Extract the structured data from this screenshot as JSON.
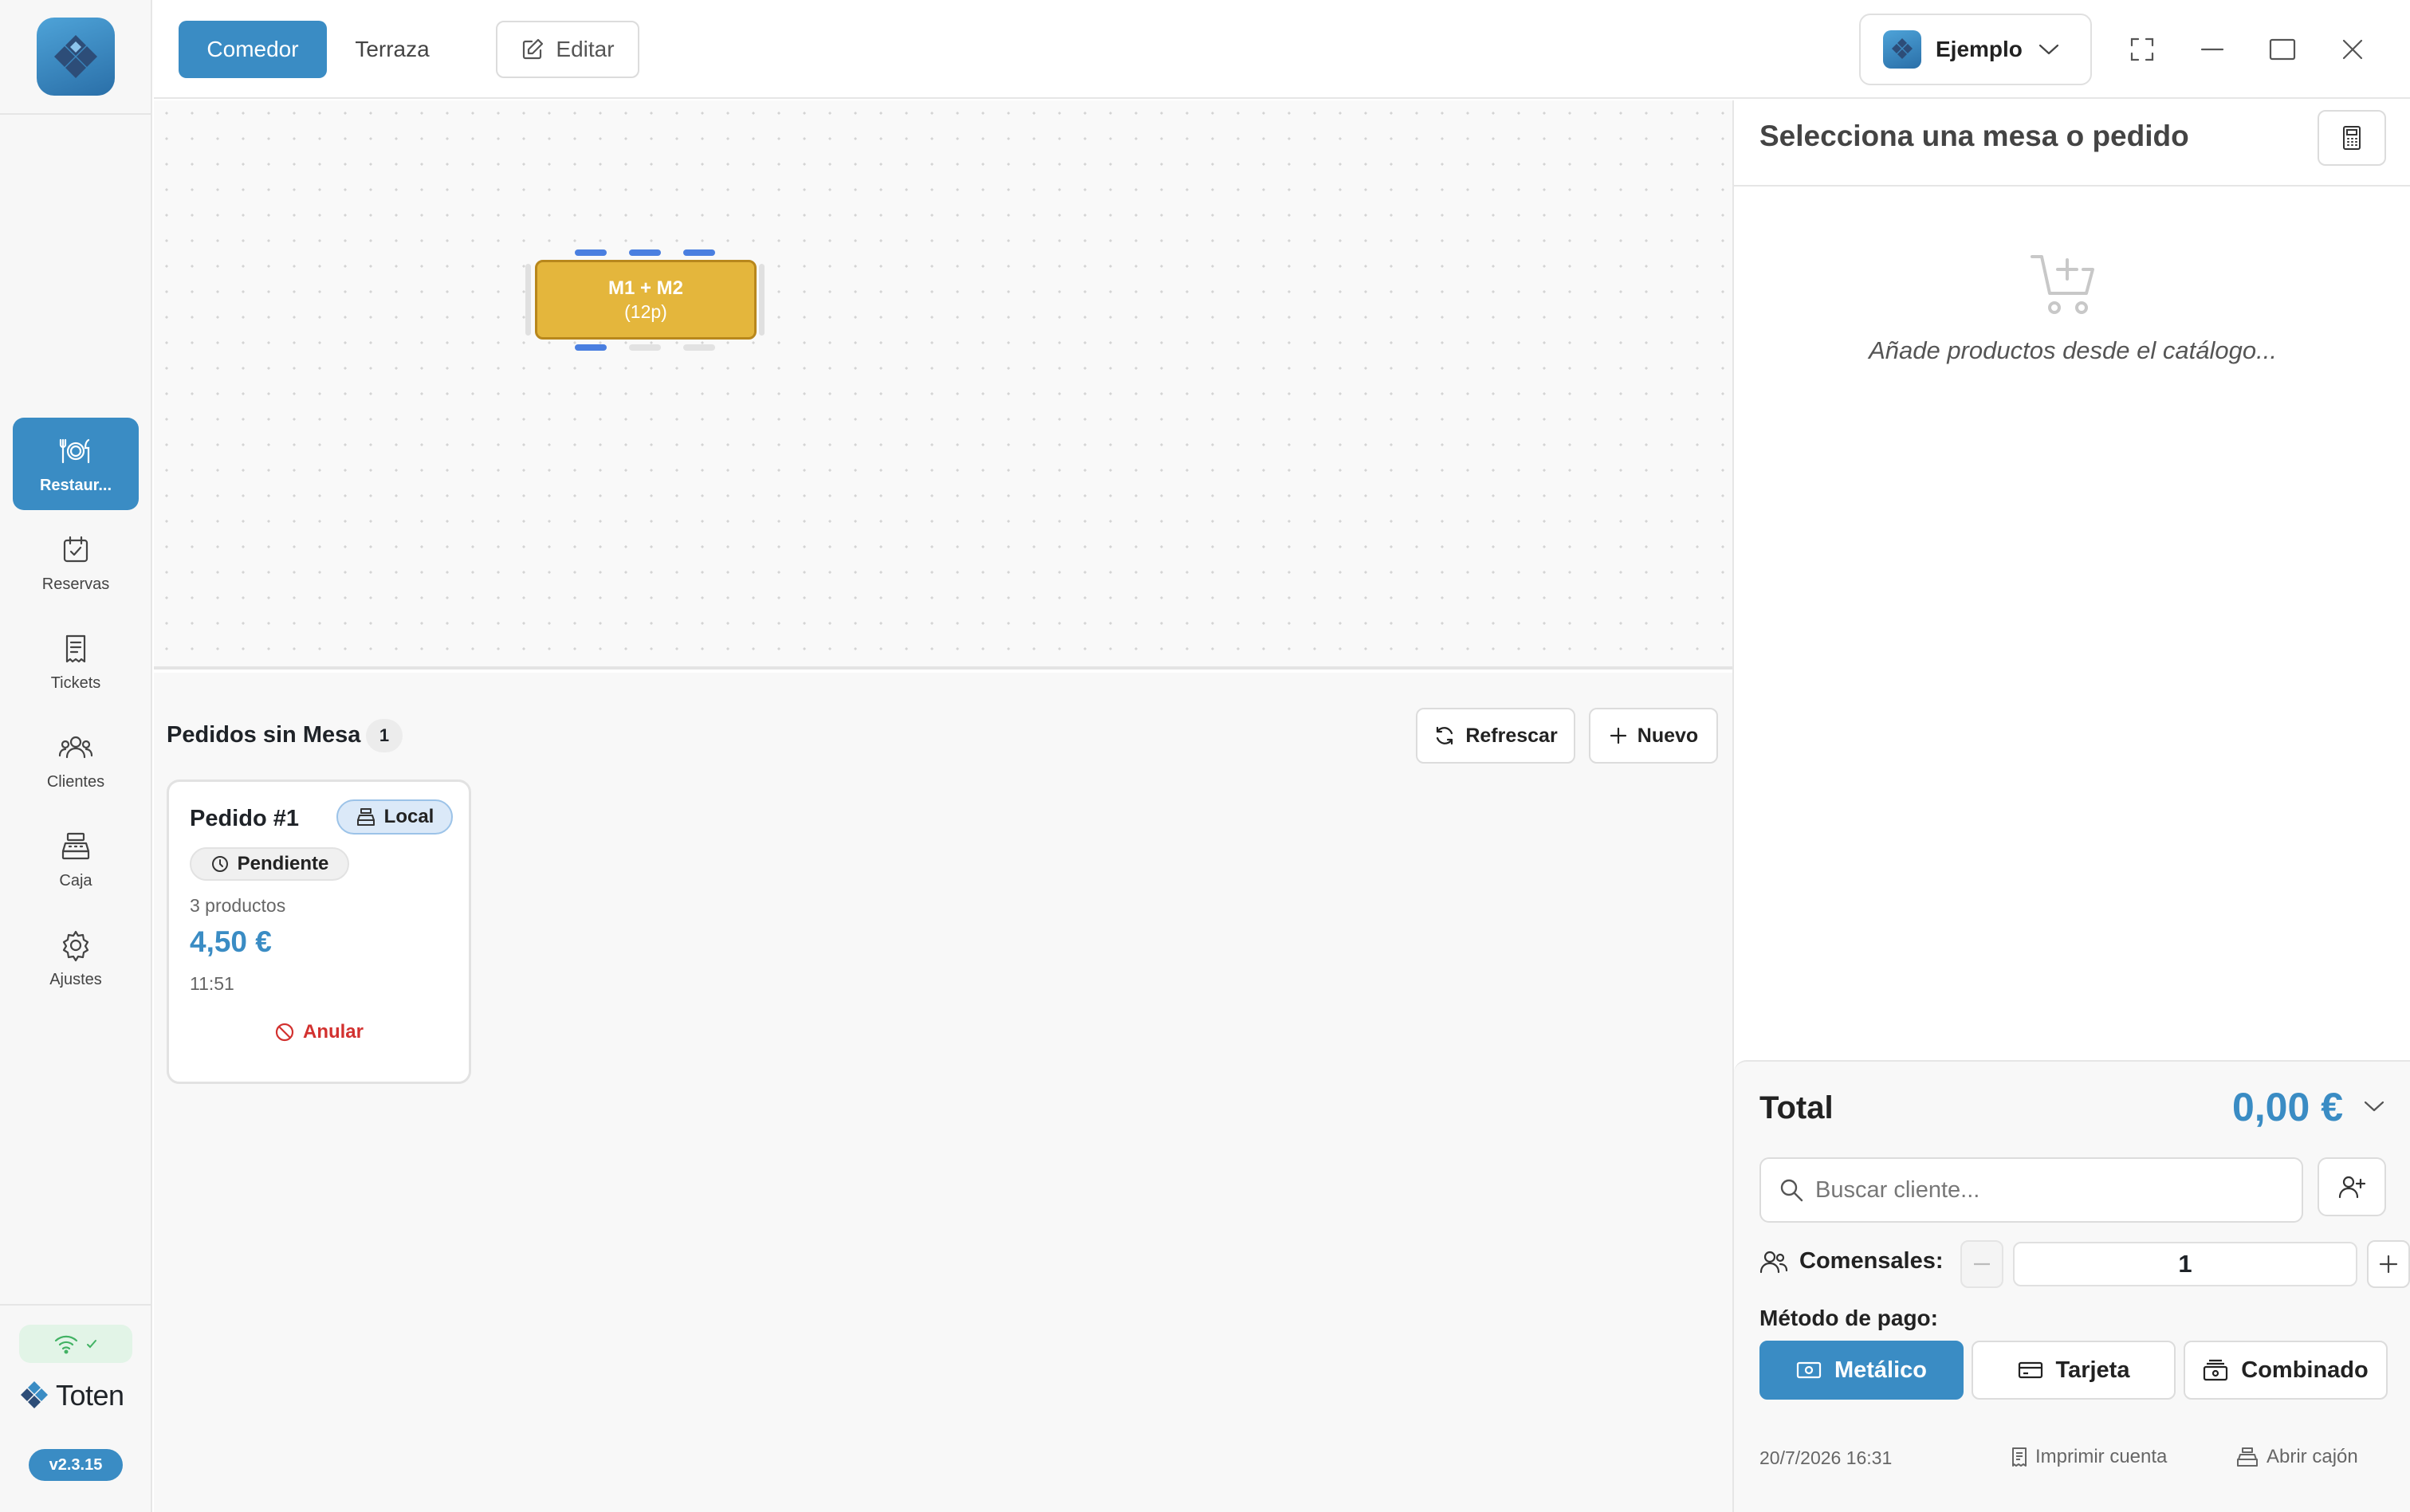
{
  "colors": {
    "accent": "#3a8cc4",
    "table": "#e4b63c",
    "danger": "#d2312f",
    "online": "#42b264"
  },
  "sidebar": {
    "items": [
      {
        "label": "Restaur...",
        "icon": "plate-cutlery-icon",
        "active": true
      },
      {
        "label": "Reservas",
        "icon": "calendar-check-icon"
      },
      {
        "label": "Tickets",
        "icon": "receipt-icon"
      },
      {
        "label": "Clientes",
        "icon": "users-icon"
      },
      {
        "label": "Caja",
        "icon": "cash-register-icon"
      },
      {
        "label": "Ajustes",
        "icon": "gear-icon"
      }
    ],
    "connection_icon": "wifi-icon",
    "brand": "Toten",
    "version": "v2.3.15"
  },
  "topbar": {
    "tabs": [
      {
        "label": "Comedor",
        "active": true
      },
      {
        "label": "Terraza",
        "active": false
      }
    ],
    "edit_label": "Editar",
    "tenant": "Ejemplo"
  },
  "floor": {
    "tables": [
      {
        "name": "M1 + M2",
        "capacity": "(12p)",
        "status_color": "#e4b63c"
      }
    ]
  },
  "orders": {
    "title": "Pedidos sin Mesa",
    "count": "1",
    "refresh_label": "Refrescar",
    "new_label": "Nuevo",
    "cards": [
      {
        "title": "Pedido #1",
        "type": "Local",
        "status": "Pendiente",
        "products": "3 productos",
        "amount": "4,50 €",
        "time": "11:51",
        "cancel_label": "Anular"
      }
    ]
  },
  "panel": {
    "title": "Selecciona una mesa o pedido",
    "empty_message": "Añade productos desde el catálogo...",
    "total_label": "Total",
    "total_amount": "0,00 €",
    "customer_search_placeholder": "Buscar cliente...",
    "customer_search_value": "",
    "diners_label": "Comensales:",
    "diners_value": "1",
    "payment_label": "Método de pago:",
    "payment_methods": [
      {
        "label": "Metálico",
        "active": true
      },
      {
        "label": "Tarjeta",
        "active": false
      },
      {
        "label": "Combinado",
        "active": false
      }
    ],
    "date": "20/7/2026 16:31",
    "print_label": "Imprimir cuenta",
    "drawer_label": "Abrir cajón"
  }
}
